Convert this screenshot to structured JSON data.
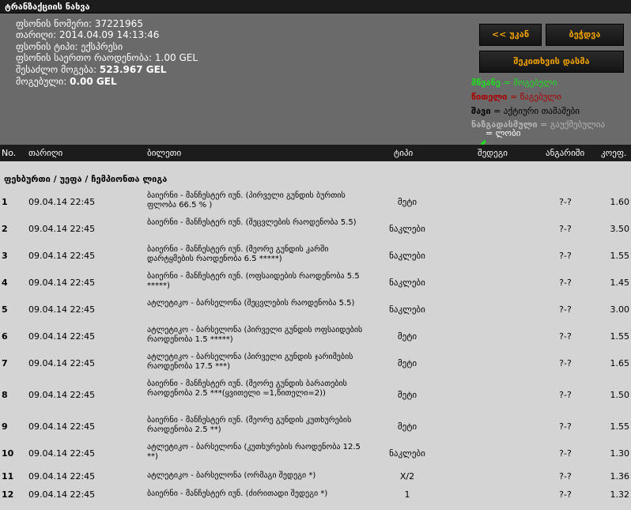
{
  "title": "ტრანზაქციის ნახვა",
  "info": {
    "coupon_no_label": "ფსონის ნომერი:",
    "coupon_no": "37221965",
    "date_label": "თარიღი:",
    "date": "2014.04.09 14:13:46",
    "type_label": "ფსონის ტიპი:",
    "type": "ექსპრესი",
    "total_label": "ფსონის საერთო რაოდენობა:",
    "total": "1.00 GEL",
    "possible_label": "შესაძლო მოგება:",
    "possible": "523.967 GEL",
    "won_label": "მოგებული:",
    "won": "0.00 GEL"
  },
  "buttons": {
    "back": "<< უკან",
    "print": "ბეჭდვა",
    "repeat": "შეკითხვის დასმა"
  },
  "legend": {
    "green_word": "მწვანე",
    "green_meaning": " = მოგებული",
    "red_word": "წითელი",
    "red_meaning": " = წაგებული",
    "black_word": "შავი",
    "black_meaning": " = აქტიური თამაშები",
    "gray_word": "ნაზგადასმული",
    "gray_meaning": " = გაუქმებულია",
    "check_meaning": " = ლობი",
    "colors": {
      "green": "#22dd22",
      "red": "#aa0000",
      "black": "#000000",
      "gray": "#b4b4b4"
    }
  },
  "table": {
    "headers": [
      "No.",
      "თარიღი",
      "ბილეთი",
      "ტიპი",
      "შედეგი",
      "ანგარიში",
      "კოეფ."
    ],
    "section": "ფეხბურთი / უეფა / ჩემპიონთა ლიგა",
    "rows": [
      {
        "no": "1",
        "date": "09.04.14 22:45",
        "bet": "ბაიერნი - მანჩესტერ იუნ. (პირველი გუნდის ბურთის ფლობა 66.5 % )",
        "type": "მეტი",
        "result": "?-?",
        "odds": "1.60"
      },
      {
        "no": "2",
        "date": "09.04.14 22:45",
        "bet": "ბაიერნი - მანჩესტერ იუნ. (შეცვლების რაოდენობა 5.5)",
        "type": "ნაკლები",
        "result": "?-?",
        "odds": "3.50"
      },
      {
        "no": "3",
        "date": "09.04.14 22:45",
        "bet": "ბაიერნი - მანჩესტერ იუნ. (მეორე გუნდის კარში დარტყმების რაოდენობა 6.5 *****)",
        "type": "ნაკლები",
        "result": "?-?",
        "odds": "1.55"
      },
      {
        "no": "4",
        "date": "09.04.14 22:45",
        "bet": "ბაიერნი - მანჩესტერ იუნ. (ოფსაიდების რაოდენობა 5.5 *****)",
        "type": "ნაკლები",
        "result": "?-?",
        "odds": "1.45"
      },
      {
        "no": "5",
        "date": "09.04.14 22:45",
        "bet": "ატლეტიკო - ბარსელონა (შეცვლების რაოდენობა 5.5)",
        "type": "ნაკლები",
        "result": "?-?",
        "odds": "3.00"
      },
      {
        "no": "6",
        "date": "09.04.14 22:45",
        "bet": "ატლეტიკო - ბარსელონა (პირველი გუნდის ოფსაიდების რაოდენობა 1.5 *****)",
        "type": "მეტი",
        "result": "?-?",
        "odds": "1.55"
      },
      {
        "no": "7",
        "date": "09.04.14 22:45",
        "bet": "ატლეტიკო - ბარსელონა (პირველი გუნდის ჯარიმების რაოდენობა 17.5 ***)",
        "type": "მეტი",
        "result": "?-?",
        "odds": "1.65"
      },
      {
        "no": "8",
        "date": "09.04.14 22:45",
        "bet": "ბაიერნი - მანჩესტერ იუნ. (მეორე გუნდის ბარათების რაოდენობა 2.5 ***(ყვითელი =1,წითელი=2))",
        "type": "მეტი",
        "result": "?-?",
        "odds": "1.50"
      },
      {
        "no": "9",
        "date": "09.04.14 22:45",
        "bet": "ბაიერნი - მანჩესტერ იუნ. (მეორე გუნდის კუთხურების რაოდენობა 2.5 **)",
        "type": "მეტი",
        "result": "?-?",
        "odds": "1.55"
      },
      {
        "no": "10",
        "date": "09.04.14 22:45",
        "bet": "ატლეტიკო - ბარსელონა (კუთხურების რაოდენობა 12.5 **)",
        "type": "ნაკლები",
        "result": "?-?",
        "odds": "1.30"
      },
      {
        "no": "11",
        "date": "09.04.14 22:45",
        "bet": "ატლეტიკო - ბარსელონა (ორმაგი შედეგი *)",
        "type": "X/2",
        "result": "?-?",
        "odds": "1.36"
      },
      {
        "no": "12",
        "date": "09.04.14 22:45",
        "bet": "ბაიერნი - მანჩესტერ იუნ. (ძირითადი შედეგი *)",
        "type": "1",
        "result": "?-?",
        "odds": "1.32"
      }
    ]
  }
}
